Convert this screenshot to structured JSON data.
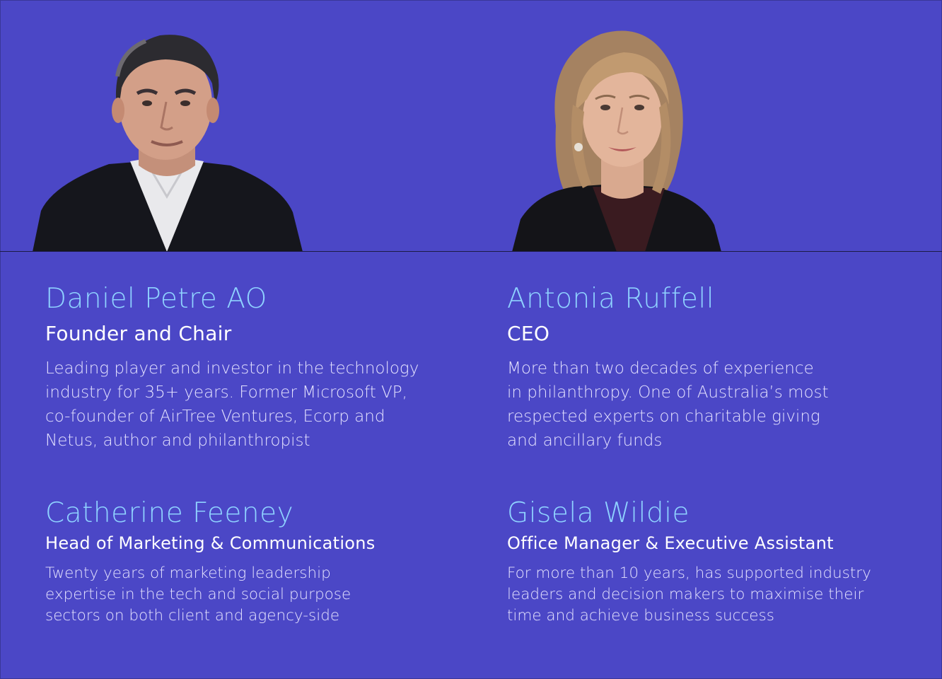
{
  "colors": {
    "background": "#4b47c6",
    "name": "#8fd2ff",
    "role": "#ffffff",
    "bio": "#e4e2ff"
  },
  "team": [
    {
      "name": "Daniel Petre AO",
      "role": "Founder and Chair",
      "bio_lines": [
        "Leading player and investor in the technology",
        "industry for 35+ years. Former Microsoft VP,",
        "co-founder of AirTree Ventures, Ecorp and",
        "Netus, author and philanthropist"
      ]
    },
    {
      "name": "Antonia Ruffell",
      "role": "CEO",
      "bio_lines": [
        "More than two decades of experience",
        "in philanthropy. One of Australia’s most",
        "respected experts on charitable giving",
        "and ancillary funds"
      ]
    },
    {
      "name": "Catherine Feeney",
      "role": "Head of Marketing & Communications",
      "bio_lines": [
        "Twenty years of marketing leadership",
        "expertise in the tech and social purpose",
        "sectors on both client and agency-side"
      ]
    },
    {
      "name": "Gisela Wildie",
      "role": "Office Manager & Executive Assistant",
      "bio_lines": [
        "For more than 10 years, has supported industry",
        "leaders and decision makers to maximise their",
        "time and achieve business success"
      ]
    }
  ]
}
